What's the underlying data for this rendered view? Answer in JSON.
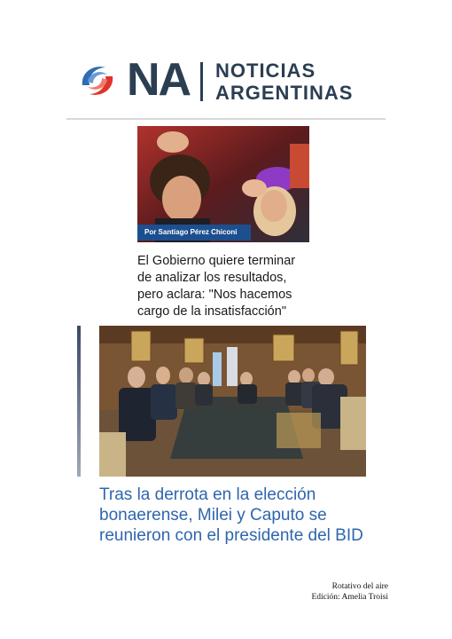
{
  "header": {
    "logo_initials": "NA",
    "logo_line1": "NOTICIAS",
    "logo_line2": "ARGENTINAS"
  },
  "article1": {
    "byline": "Por Santiago Pérez Chiconi",
    "headline_lines": [
      "El Gobierno quiere terminar",
      "de analizar los resultados,",
      "pero aclara: \"Nos hacemos",
      "cargo de la insatisfacción\""
    ]
  },
  "article2": {
    "headline_lines": [
      "Tras la derrota en la elección",
      "bonaerense, Milei y Caputo se",
      "reunieron con el presidente del BID"
    ]
  },
  "footer": {
    "line1": "Rotativo del aire",
    "line2": "Edición: Amelia Troisi"
  },
  "colors": {
    "brand_dark": "#2b3e52",
    "byline_blue": "#1d4f8f",
    "headline_blue": "#2f66ad"
  }
}
